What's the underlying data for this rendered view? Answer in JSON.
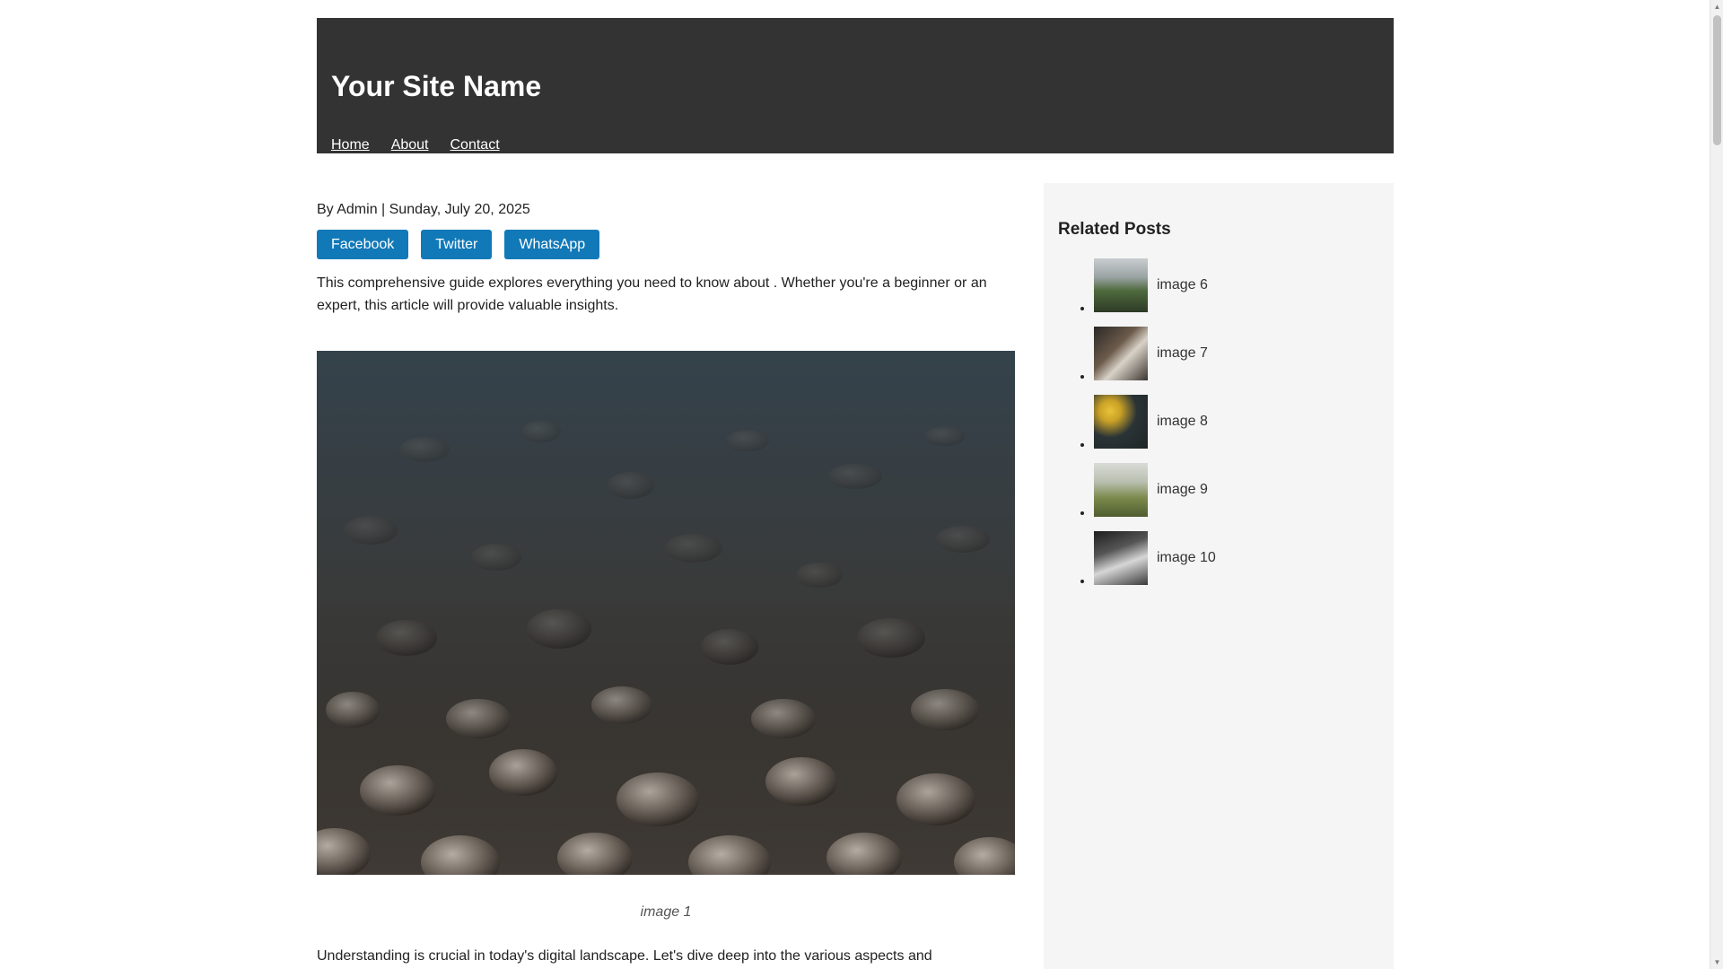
{
  "header": {
    "site_title": "Your Site Name",
    "nav": [
      {
        "label": "Home"
      },
      {
        "label": "About"
      },
      {
        "label": "Contact"
      }
    ]
  },
  "article": {
    "meta": "By Admin | Sunday, July 20, 2025",
    "share_buttons": [
      {
        "label": "Facebook"
      },
      {
        "label": "Twitter"
      },
      {
        "label": "WhatsApp"
      }
    ],
    "intro": "This comprehensive guide explores everything you need to know about . Whether you're a beginner or an expert, this article will provide valuable insights.",
    "hero_caption": "image 1",
    "body": "Understanding is crucial in today's digital landscape. Let's dive deep into the various aspects and"
  },
  "sidebar": {
    "title": "Related Posts",
    "items": [
      {
        "label": "image 6"
      },
      {
        "label": "image 7"
      },
      {
        "label": "image 8"
      },
      {
        "label": "image 9"
      },
      {
        "label": "image 10"
      }
    ]
  },
  "colors": {
    "header_bg": "#333333",
    "share_button_bg": "#1279b8",
    "sidebar_bg": "#f5f5f5"
  }
}
